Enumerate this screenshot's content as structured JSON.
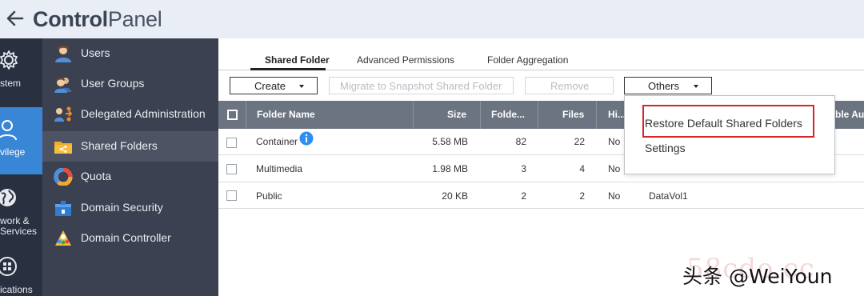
{
  "window": {
    "title_bold": "Control",
    "title_light": "Panel"
  },
  "rail": {
    "items": [
      {
        "icon": "gear-icon",
        "label": "stem"
      },
      {
        "icon": "user-icon",
        "label": "vilege"
      },
      {
        "icon": "globe-icon",
        "label_line1": "work &",
        "label_line2": "Services"
      },
      {
        "icon": "apps-grid-icon",
        "label": "ications"
      }
    ]
  },
  "menu": {
    "items": [
      {
        "icon": "user-icon",
        "label": "Users"
      },
      {
        "icon": "user-groups-icon",
        "label": "User Groups"
      },
      {
        "icon": "delegated-admin-icon",
        "label": "Delegated Administration"
      },
      {
        "icon": "shared-folder-icon",
        "label": "Shared Folders"
      },
      {
        "icon": "quota-icon",
        "label": "Quota"
      },
      {
        "icon": "domain-security-icon",
        "label": "Domain Security"
      },
      {
        "icon": "domain-controller-icon",
        "label": "Domain Controller"
      }
    ]
  },
  "tabs": [
    {
      "label": "Shared Folder"
    },
    {
      "label": "Advanced Permissions"
    },
    {
      "label": "Folder Aggregation"
    }
  ],
  "toolbar": {
    "create": "Create",
    "migrate": "Migrate to Snapshot Shared Folder",
    "remove": "Remove",
    "others": "Others"
  },
  "table": {
    "headers": [
      "Folder Name",
      "Size",
      "Folde...",
      "Files",
      "Hi..."
    ],
    "cut_header": "ble Au",
    "rows": [
      {
        "name": "Container",
        "size": "5.58 MB",
        "folders": "82",
        "files": "22",
        "hidden": "No",
        "volume": ""
      },
      {
        "name": "Multimedia",
        "size": "1.98 MB",
        "folders": "3",
        "files": "4",
        "hidden": "No",
        "volume": ""
      },
      {
        "name": "Public",
        "size": "20 KB",
        "folders": "2",
        "files": "2",
        "hidden": "No",
        "volume": "DataVol1"
      }
    ]
  },
  "dropdown": {
    "items": [
      "Restore Default Shared Folders",
      "Settings"
    ]
  },
  "watermark": {
    "text": "头条 @WeiYoun",
    "faint": "58cdo.cc"
  },
  "colors": {
    "accent": "#3a86d6",
    "highlight_border": "#d8232a",
    "table_header": "#6b7480",
    "menu_bg": "#3b4150"
  }
}
